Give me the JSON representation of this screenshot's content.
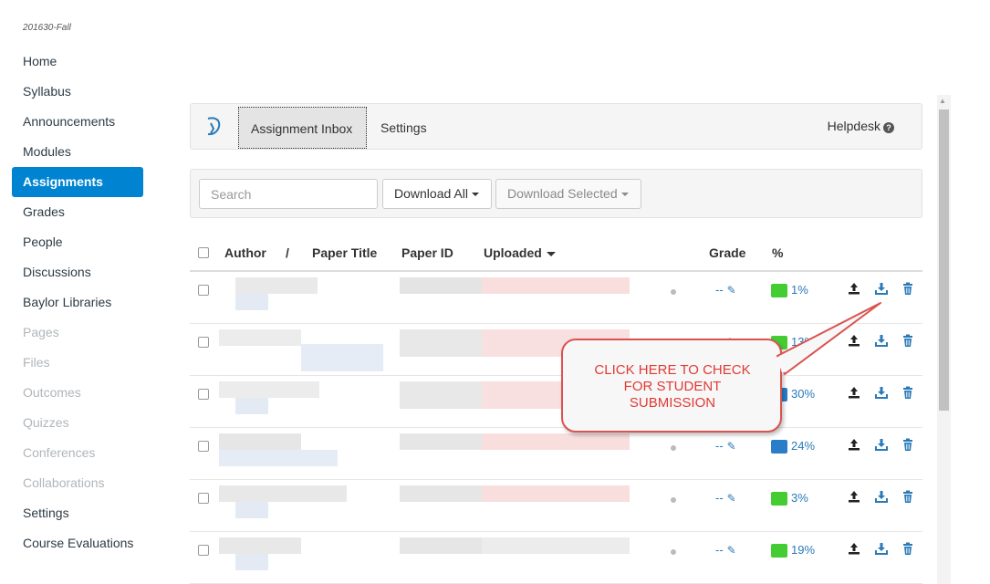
{
  "term": "201630-Fall",
  "nav": [
    {
      "label": "Home",
      "state": "normal"
    },
    {
      "label": "Syllabus",
      "state": "normal"
    },
    {
      "label": "Announcements",
      "state": "normal"
    },
    {
      "label": "Modules",
      "state": "normal"
    },
    {
      "label": "Assignments",
      "state": "active"
    },
    {
      "label": "Grades",
      "state": "normal"
    },
    {
      "label": "People",
      "state": "normal"
    },
    {
      "label": "Discussions",
      "state": "normal"
    },
    {
      "label": "Baylor Libraries",
      "state": "normal"
    },
    {
      "label": "Pages",
      "state": "disabled"
    },
    {
      "label": "Files",
      "state": "disabled"
    },
    {
      "label": "Outcomes",
      "state": "disabled"
    },
    {
      "label": "Quizzes",
      "state": "disabled"
    },
    {
      "label": "Conferences",
      "state": "disabled"
    },
    {
      "label": "Collaborations",
      "state": "disabled"
    },
    {
      "label": "Settings",
      "state": "normal"
    },
    {
      "label": "Course Evaluations",
      "state": "normal"
    }
  ],
  "toolbar": {
    "tab_inbox": "Assignment Inbox",
    "tab_settings": "Settings",
    "helpdesk": "Helpdesk",
    "help_icon": "?"
  },
  "filters": {
    "search_placeholder": "Search",
    "download_all": "Download All",
    "download_selected": "Download Selected"
  },
  "table": {
    "headers": {
      "author": "Author",
      "sep": "/",
      "paper_title": "Paper Title",
      "paper_id": "Paper ID",
      "uploaded": "Uploaded",
      "grade": "Grade",
      "percent": "%"
    },
    "rows": [
      {
        "grade": "--",
        "similarity": "1%",
        "color": "#44cc33"
      },
      {
        "grade": "--",
        "similarity": "13%",
        "color": "#44cc33"
      },
      {
        "grade": "--",
        "similarity": "30%",
        "color": "#2a7ec8"
      },
      {
        "grade": "--",
        "similarity": "24%",
        "color": "#2a7ec8"
      },
      {
        "grade": "--",
        "similarity": "3%",
        "color": "#44cc33"
      },
      {
        "grade": "--",
        "similarity": "19%",
        "color": "#44cc33"
      }
    ]
  },
  "callout": {
    "line1": "CLICK HERE TO CHECK",
    "line2": "FOR STUDENT",
    "line3": "SUBMISSION"
  },
  "icons": {
    "upload": "upload-icon",
    "download": "download-icon",
    "trash": "trash-icon",
    "pencil": "pencil-icon"
  }
}
